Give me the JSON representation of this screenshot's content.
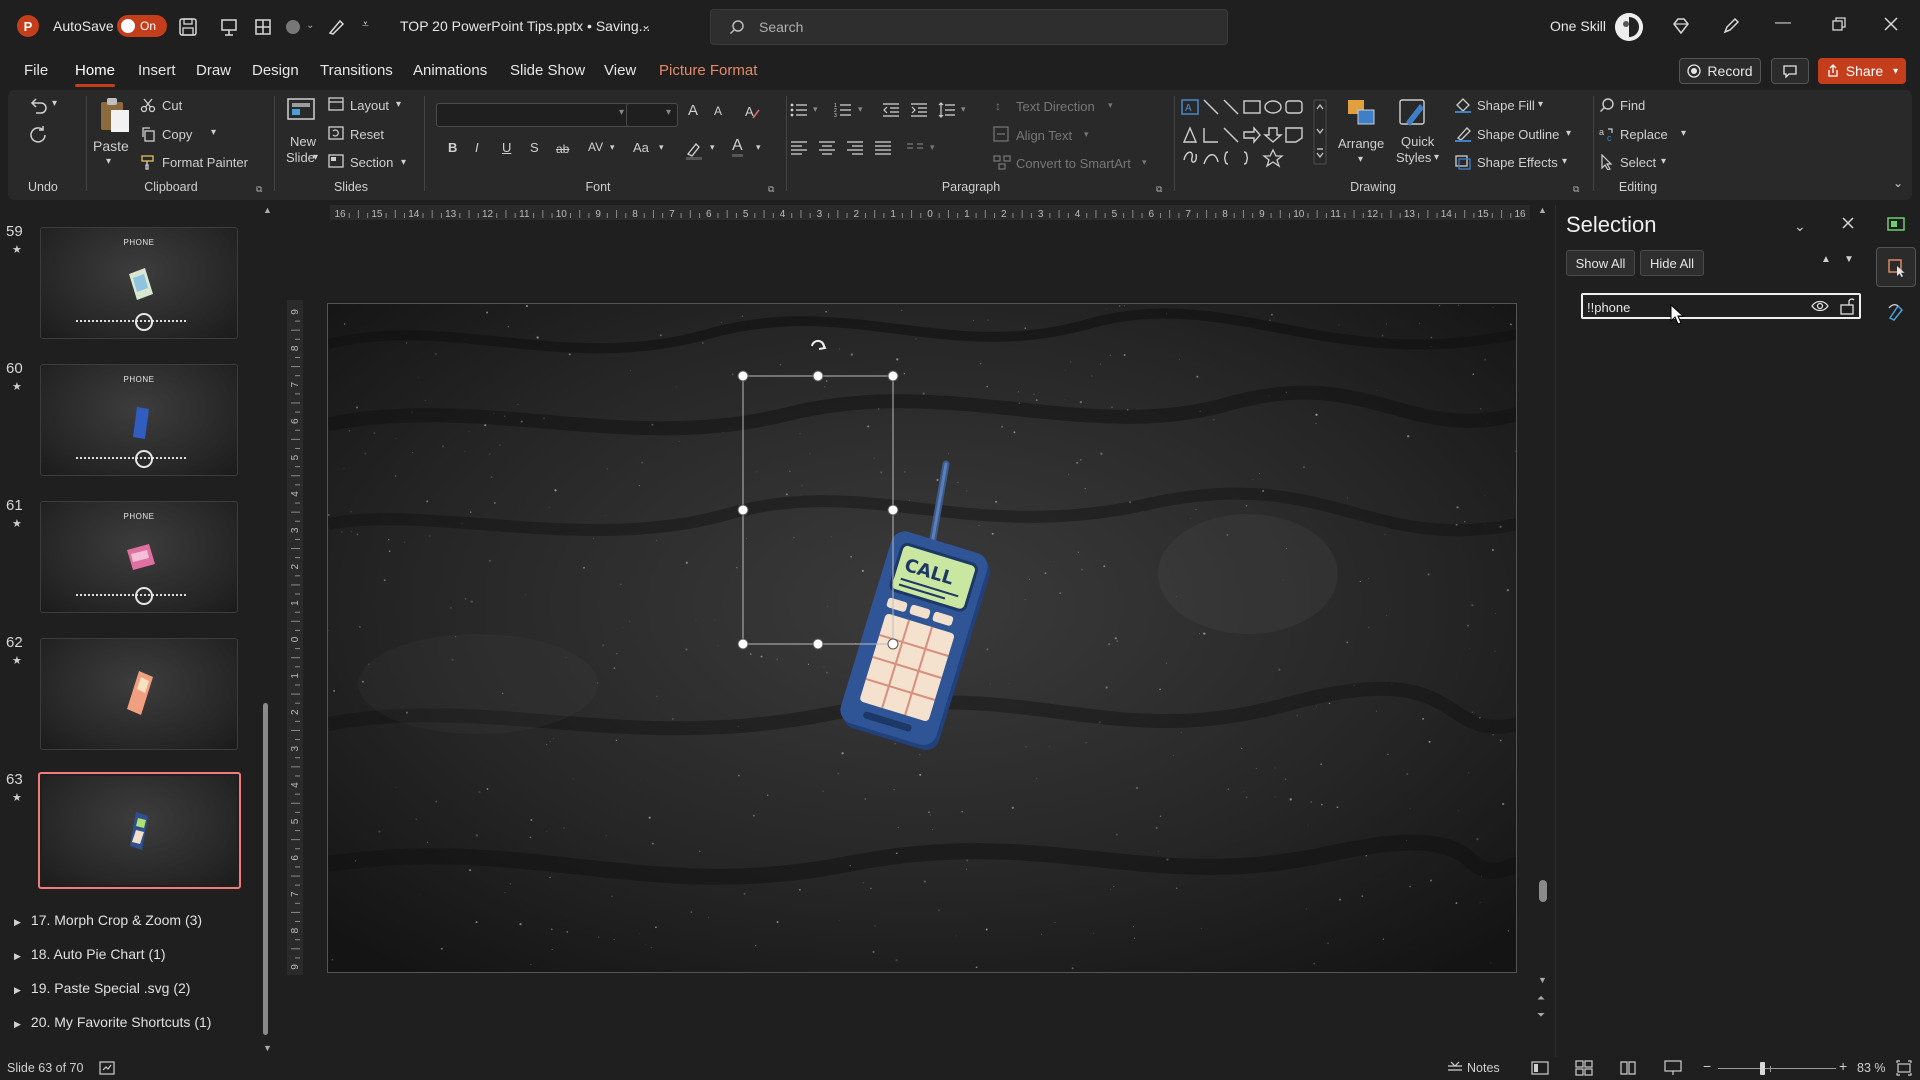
{
  "titlebar": {
    "autosave_label": "AutoSave",
    "autosave_state": "On",
    "document_title": "TOP 20 PowerPoint Tips.pptx • Saving...",
    "search_placeholder": "Search",
    "user_name": "One Skill"
  },
  "menu": {
    "tabs": [
      "File",
      "Home",
      "Insert",
      "Draw",
      "Design",
      "Transitions",
      "Animations",
      "Slide Show",
      "View",
      "Picture Format"
    ],
    "active": "Home",
    "record_label": "Record",
    "share_label": "Share"
  },
  "ribbon": {
    "undo_group": "Undo",
    "clipboard": {
      "paste": "Paste",
      "cut": "Cut",
      "copy": "Copy",
      "format_painter": "Format Painter",
      "group": "Clipboard"
    },
    "slides": {
      "new_slide_1": "New",
      "new_slide_2": "Slide",
      "layout": "Layout",
      "reset": "Reset",
      "section": "Section",
      "group": "Slides"
    },
    "font": {
      "group": "Font",
      "bold": "B",
      "italic": "I",
      "underline": "U",
      "shadow": "S",
      "strike": "ab",
      "spacing": "AV",
      "case": "Aa",
      "grow": "A",
      "shrink": "A",
      "color": "A"
    },
    "paragraph": {
      "group": "Paragraph",
      "text_direction": "Text Direction",
      "align_text": "Align Text",
      "smartart": "Convert to SmartArt"
    },
    "drawing": {
      "group": "Drawing",
      "arrange": "Arrange",
      "quick_styles_1": "Quick",
      "quick_styles_2": "Styles",
      "shape_fill": "Shape Fill",
      "shape_outline": "Shape Outline",
      "shape_effects": "Shape Effects"
    },
    "editing": {
      "group": "Editing",
      "find": "Find",
      "replace": "Replace",
      "select": "Select"
    }
  },
  "slides_panel": {
    "thumbs": [
      {
        "num": "59",
        "star": "★",
        "title": "PHONE"
      },
      {
        "num": "60",
        "star": "★",
        "title": "PHONE"
      },
      {
        "num": "61",
        "star": "★",
        "title": "PHONE"
      },
      {
        "num": "62",
        "star": "★",
        "title": ""
      },
      {
        "num": "63",
        "star": "★",
        "title": ""
      }
    ],
    "sections": [
      "17. Morph Crop & Zoom (3)",
      "18. Auto Pie Chart (1)",
      "19. Paste Special .svg (2)",
      "20. My Favorite Shortcuts (1)"
    ]
  },
  "ruler": {
    "h_ticks": [
      "16",
      "15",
      "14",
      "13",
      "12",
      "11",
      "10",
      "9",
      "8",
      "7",
      "6",
      "5",
      "4",
      "3",
      "2",
      "1",
      "0",
      "1",
      "2",
      "3",
      "4",
      "5",
      "6",
      "7",
      "8",
      "9",
      "10",
      "11",
      "12",
      "13",
      "14",
      "15",
      "16"
    ],
    "v_ticks": [
      "9",
      "8",
      "7",
      "6",
      "5",
      "4",
      "3",
      "2",
      "1",
      "0",
      "1",
      "2",
      "3",
      "4",
      "5",
      "6",
      "7",
      "8",
      "9"
    ]
  },
  "slide": {
    "phone_screen_text": "CALL"
  },
  "selection_pane": {
    "title": "Selection",
    "show_all": "Show All",
    "hide_all": "Hide All",
    "item_value": "!!phone"
  },
  "statusbar": {
    "slide_info": "Slide 63 of 70",
    "notes": "Notes",
    "zoom": "83 %"
  },
  "colors": {
    "accent": "#c43e1c",
    "picture_format_tab": "#e58a68",
    "selected_thumb_border": "#f07b7b"
  }
}
